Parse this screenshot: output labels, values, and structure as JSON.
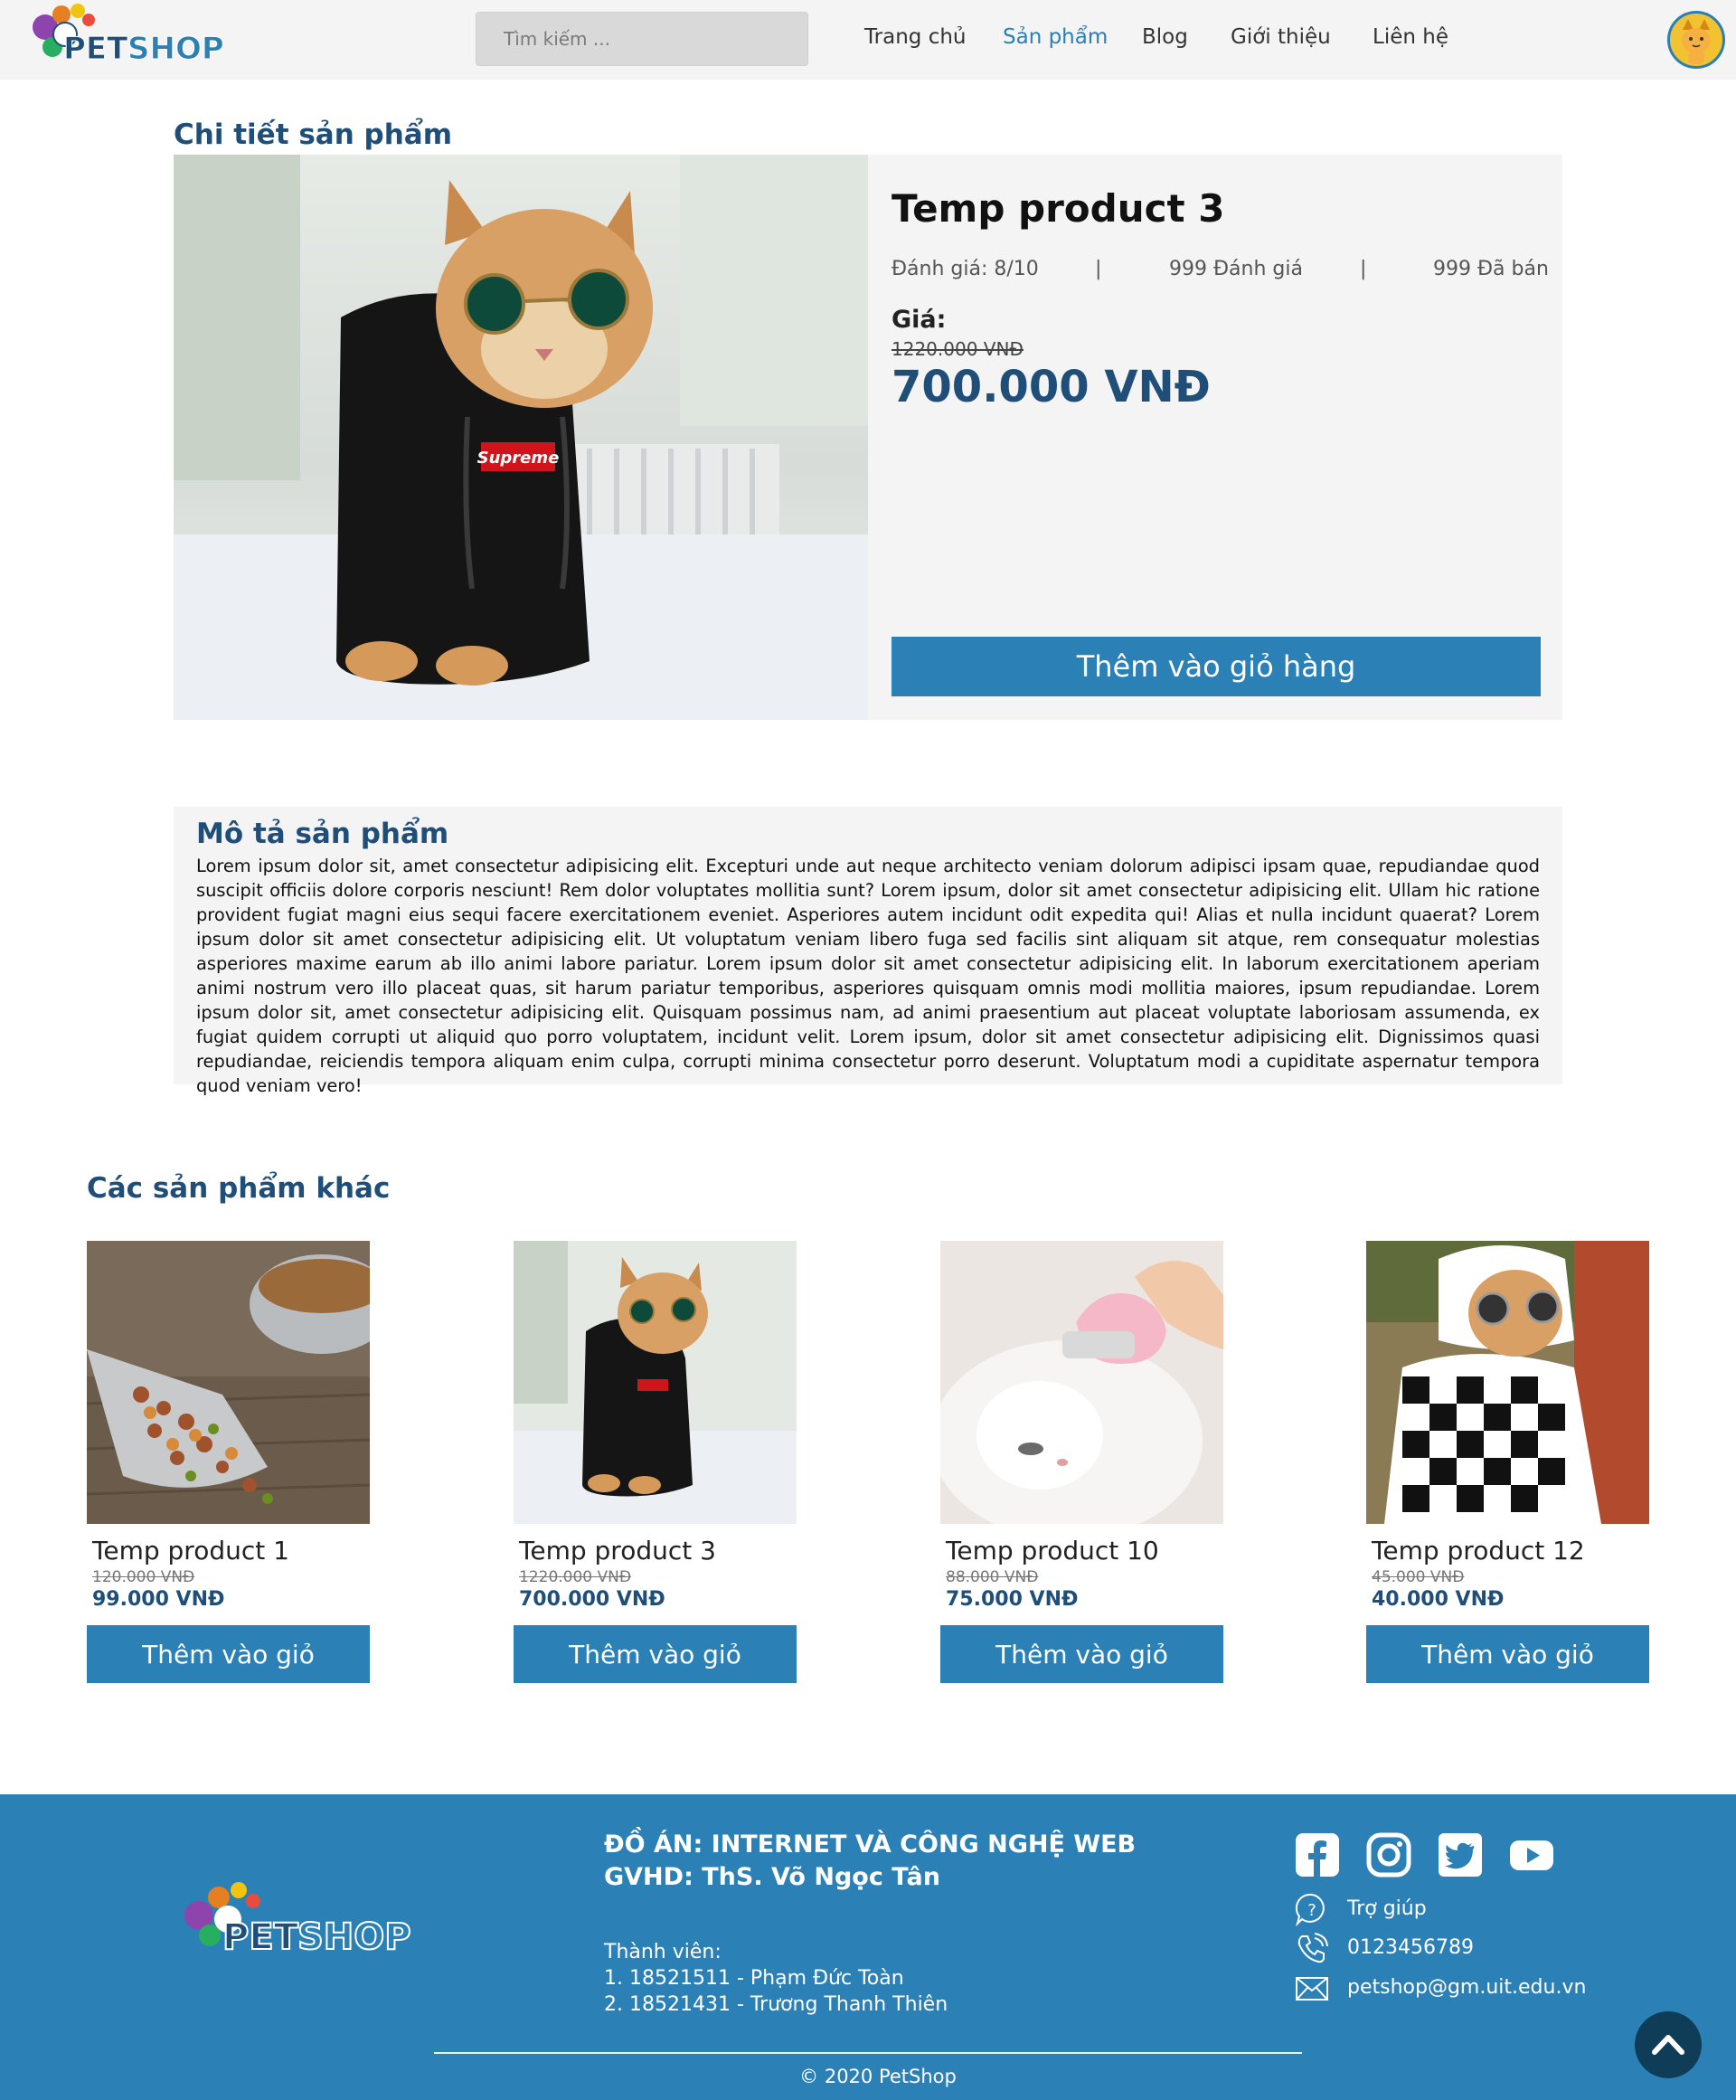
{
  "header": {
    "logo_text": "PETSHOP",
    "search_placeholder": "Tìm kiếm ...",
    "nav": [
      {
        "label": "Trang chủ",
        "active": false
      },
      {
        "label": "Sản phẩm",
        "active": true
      },
      {
        "label": "Blog",
        "active": false
      },
      {
        "label": "Giới thiệu",
        "active": false
      },
      {
        "label": "Liên hệ",
        "active": false
      }
    ]
  },
  "detail": {
    "section_title": "Chi tiết sản phẩm",
    "product_name": "Temp product 3",
    "rating": "Đánh giá: 8/10",
    "separator": "|",
    "reviews": "999 Đánh giá",
    "sold": "999 Đã bán",
    "price_label": "Giá:",
    "old_price": "1220.000 VNĐ",
    "new_price": "700.000 VNĐ",
    "add_to_cart": "Thêm vào giỏ hàng"
  },
  "description": {
    "title": "Mô tả sản phẩm",
    "text": "Lorem ipsum dolor sit, amet consectetur adipisicing elit. Excepturi unde aut neque architecto veniam dolorum adipisci ipsam quae, repudiandae quod suscipit officiis dolore corporis nesciunt! Rem dolor voluptates mollitia sunt? Lorem ipsum, dolor sit amet consectetur adipisicing elit. Ullam hic ratione provident fugiat magni eius sequi facere exercitationem eveniet. Asperiores autem incidunt odit expedita qui! Alias et nulla incidunt quaerat? Lorem ipsum dolor sit amet consectetur adipisicing elit. Ut voluptatum veniam libero fuga sed facilis sint aliquam sit atque, rem consequatur molestias asperiores maxime earum ab illo animi labore pariatur. Lorem ipsum dolor sit amet consectetur adipisicing elit. In laborum exercitationem aperiam animi nostrum vero illo placeat quas, sit harum pariatur temporibus, asperiores quisquam omnis modi mollitia maiores, ipsum repudiandae. Lorem ipsum dolor sit, amet consectetur adipisicing elit. Quisquam possimus nam, ad animi praesentium aut placeat voluptate laboriosam assumenda, ex fugiat quidem corrupti ut aliquid quo porro voluptatem, incidunt velit. Lorem ipsum, dolor sit amet consectetur adipisicing elit. Dignissimos quasi repudiandae, reiciendis tempora aliquam enim culpa, corrupti minima consectetur porro deserunt. Voluptatum modi a cupiditate aspernatur tempora quod veniam vero!"
  },
  "related": {
    "title": "Các sản phẩm khác",
    "items": [
      {
        "name": "Temp product 1",
        "old_price": "120.000 VNĐ",
        "new_price": "99.000 VNĐ",
        "button": "Thêm vào giỏ",
        "image": "pet-food"
      },
      {
        "name": "Temp product 3",
        "old_price": "1220.000 VNĐ",
        "new_price": "700.000 VNĐ",
        "button": "Thêm vào giỏ",
        "image": "cat-hoodie"
      },
      {
        "name": "Temp product 10",
        "old_price": "88.000 VNĐ",
        "new_price": "75.000 VNĐ",
        "button": "Thêm vào giỏ",
        "image": "cat-brush"
      },
      {
        "name": "Temp product 12",
        "old_price": "45.000 VNĐ",
        "new_price": "40.000 VNĐ",
        "button": "Thêm vào giỏ",
        "image": "cat-checkered"
      }
    ]
  },
  "footer": {
    "project_line1": "ĐỒ ÁN: INTERNET VÀ CÔNG NGHỆ WEB",
    "project_line2": "GVHD: ThS. Võ Ngọc Tân",
    "members_label": "Thành viên:",
    "member1": "1. 18521511 - Phạm Đức Toàn",
    "member2": "2. 18521431 - Trương Thanh Thiên",
    "help": "Trợ giúp",
    "phone": "0123456789",
    "email": "petshop@gm.uit.edu.vn",
    "copyright": "© 2020 PetShop",
    "social": [
      "facebook-icon",
      "instagram-icon",
      "twitter-icon",
      "youtube-icon"
    ]
  },
  "colors": {
    "primary": "#2b80b6",
    "heading": "#1f4e79",
    "panel": "#f4f4f4",
    "to_top": "#0f3d57"
  }
}
